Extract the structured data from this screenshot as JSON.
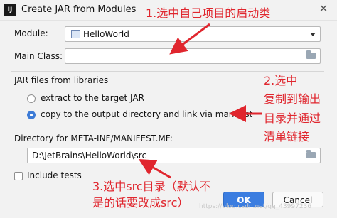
{
  "window": {
    "app_icon": "intellij-icon",
    "app_icon_text": "IJ",
    "title": "Create JAR from Modules",
    "close_glyph": "✕"
  },
  "module": {
    "label": "Module:",
    "value": "HelloWorld"
  },
  "main_class": {
    "label": "Main Class:",
    "value": ""
  },
  "jar_files": {
    "group_label": "JAR files from libraries",
    "options": [
      {
        "label": "extract to the target JAR",
        "selected": false
      },
      {
        "label": "copy to the output directory and link via manifest",
        "selected": true
      }
    ]
  },
  "manifest_dir": {
    "label": "Directory for META-INF/MANIFEST.MF:",
    "value": "D:\\JetBrains\\HelloWorld\\src"
  },
  "include_tests": {
    "label": "Include tests",
    "checked": false
  },
  "buttons": {
    "ok": "OK",
    "cancel": "Cancel"
  },
  "annotations": {
    "note1": "1.选中自己项目的启动类",
    "note2_lines": [
      "2.选中",
      "复制到输出",
      "目录并通过",
      "清单链接"
    ],
    "note3_lines": [
      "3.选中src目录（默认不",
      "是的话要改成src）"
    ],
    "color": "#e0262e"
  },
  "watermark": "https://blog.csdn.net/qq_43997236"
}
